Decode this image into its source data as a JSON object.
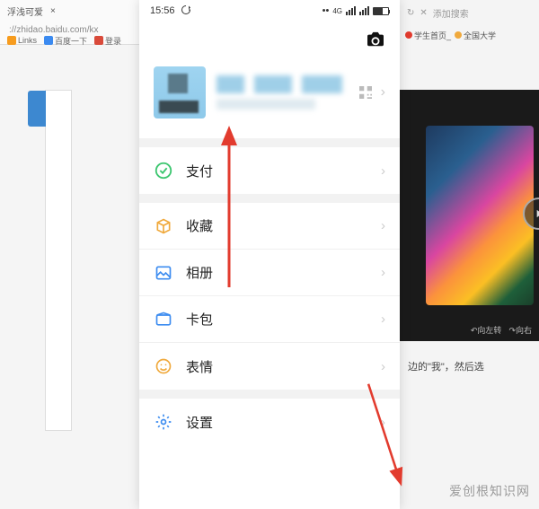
{
  "browser": {
    "tab_title": "浮浅可爱",
    "tab_close": "×",
    "url": "://zhidao.baidu.com/kx",
    "bookmarks": [
      "Links",
      "百度一下",
      "登录"
    ],
    "right_controls": {
      "prompt": "添加搜索"
    },
    "right_tabs_1": "学生首页_",
    "right_tabs_2": "全国大学",
    "video_prev": "向左转",
    "video_next": "向右",
    "context_text": "边的\"我\"，然后选"
  },
  "status": {
    "time": "15:56",
    "net_label": "4G"
  },
  "profile": {
    "qr_label": "qr-code"
  },
  "menu": {
    "pay": "支付",
    "favorites": "收藏",
    "album": "相册",
    "cards": "卡包",
    "stickers": "表情",
    "settings": "设置"
  },
  "icons": {
    "chevron": "›"
  },
  "watermark": "爱创根知识网",
  "colors": {
    "pay": "#3cc66f",
    "favorites": "#f0a93c",
    "album": "#3c8cf0",
    "cards": "#3c8cf0",
    "stickers": "#f0a93c",
    "settings": "#3c8cf0",
    "arrow": "#e23b2e"
  }
}
